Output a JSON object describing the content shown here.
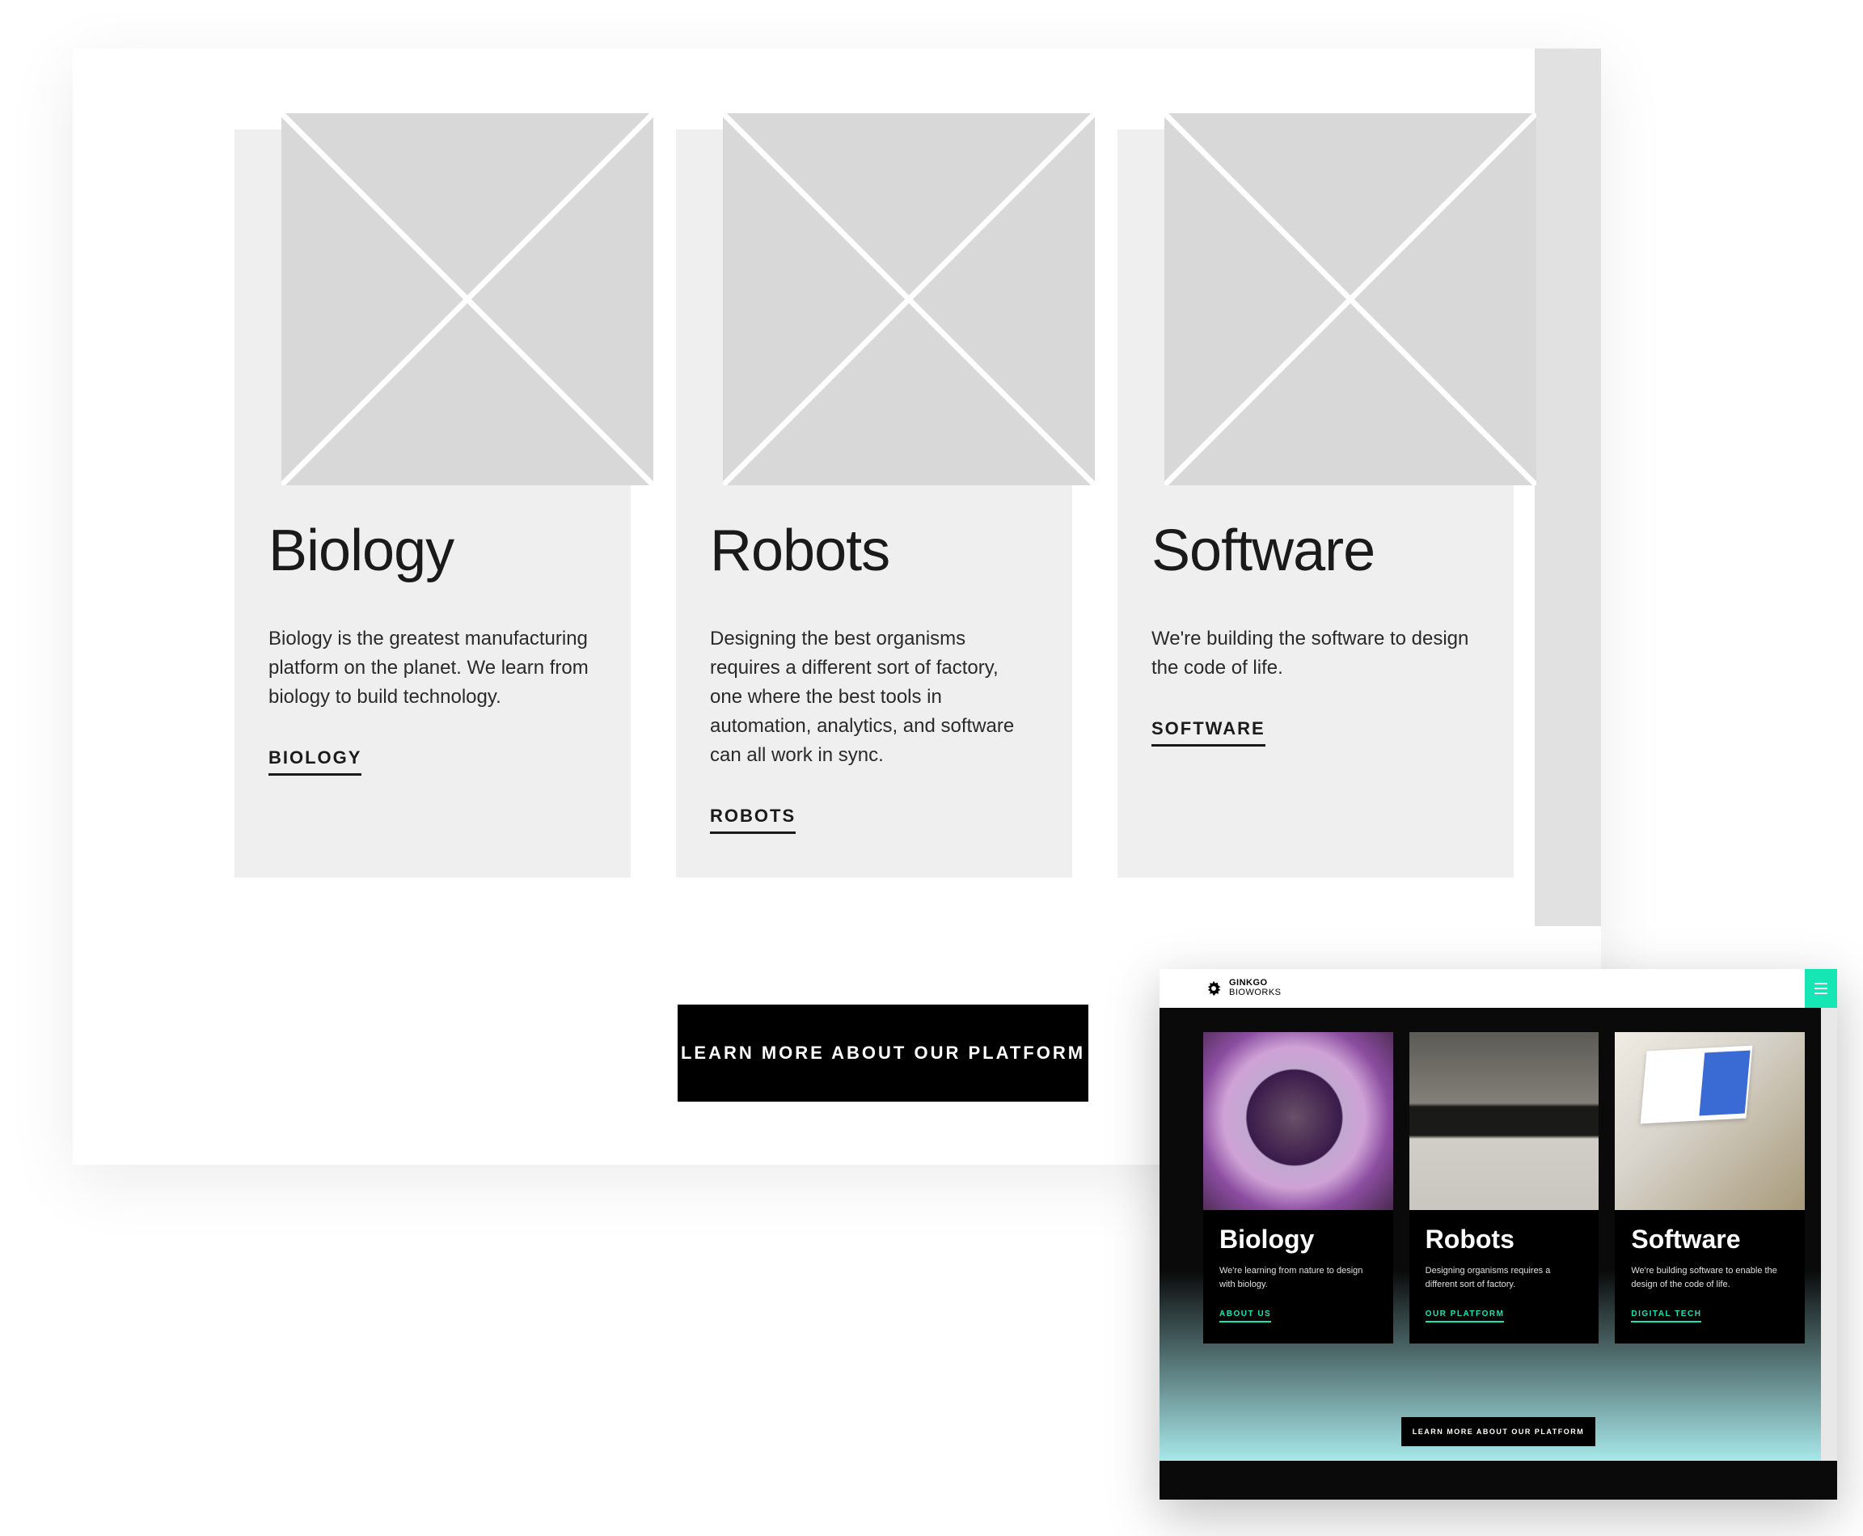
{
  "wireframe": {
    "cards": [
      {
        "title": "Biology",
        "desc": "Biology is the greatest manufacturing platform on the planet. We learn from biology to build technology.",
        "link": "BIOLOGY"
      },
      {
        "title": "Robots",
        "desc": "Designing the best organisms requires a different sort of factory, one where the best tools in automation, analytics, and software can all work in sync.",
        "link": "ROBOTS"
      },
      {
        "title": "Software",
        "desc": "We're building the software to design the code of life.",
        "link": "SOFTWARE"
      }
    ],
    "cta": "LEARN MORE ABOUT OUR PLATFORM"
  },
  "preview": {
    "brand_line1": "GINKGO",
    "brand_line2": "BIOWORKS",
    "cards": [
      {
        "title": "Biology",
        "desc": "We're learning from nature to design with biology.",
        "link": "ABOUT US"
      },
      {
        "title": "Robots",
        "desc": "Designing organisms requires a different sort of factory.",
        "link": "OUR PLATFORM"
      },
      {
        "title": "Software",
        "desc": "We're building software to enable the design of the code of life.",
        "link": "DIGITAL TECH"
      }
    ],
    "cta": "LEARN MORE ABOUT OUR PLATFORM"
  }
}
